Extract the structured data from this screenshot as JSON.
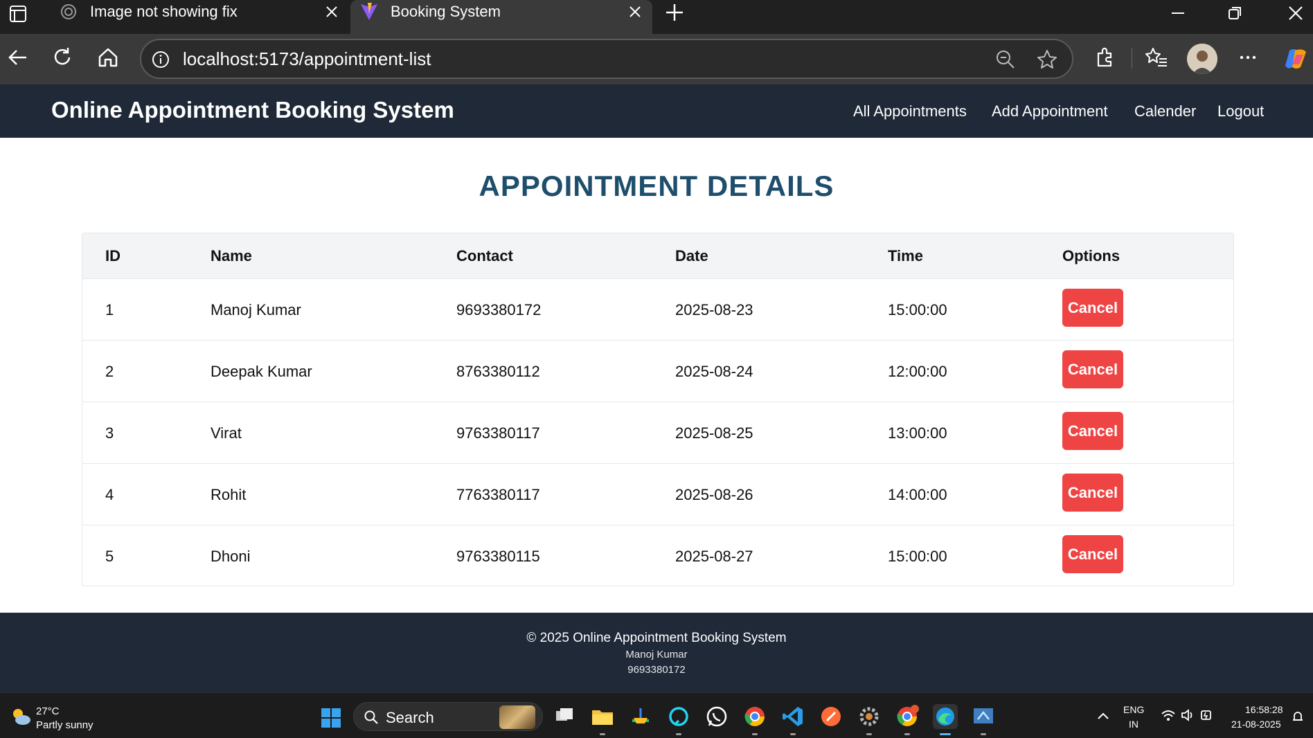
{
  "browser": {
    "tabs": [
      {
        "title": "Image not showing fix",
        "favicon": "openai-icon",
        "active": false
      },
      {
        "title": "Booking System",
        "favicon": "vite-icon",
        "active": true
      }
    ],
    "url": "localhost:5173/appointment-list"
  },
  "site": {
    "brand": "Online Appointment Booking System",
    "nav": [
      "All Appointments",
      "Add Appointment",
      "Calender",
      "Logout"
    ]
  },
  "page": {
    "title": "APPOINTMENT DETAILS",
    "columns": [
      "ID",
      "Name",
      "Contact",
      "Date",
      "Time",
      "Options"
    ],
    "rows": [
      {
        "id": "1",
        "name": "Manoj Kumar",
        "contact": "9693380172",
        "date": "2025-08-23",
        "time": "15:00:00",
        "action": "Cancel"
      },
      {
        "id": "2",
        "name": "Deepak Kumar",
        "contact": "8763380112",
        "date": "2025-08-24",
        "time": "12:00:00",
        "action": "Cancel"
      },
      {
        "id": "3",
        "name": "Virat",
        "contact": "9763380117",
        "date": "2025-08-25",
        "time": "13:00:00",
        "action": "Cancel"
      },
      {
        "id": "4",
        "name": "Rohit",
        "contact": "7763380117",
        "date": "2025-08-26",
        "time": "14:00:00",
        "action": "Cancel"
      },
      {
        "id": "5",
        "name": "Dhoni",
        "contact": "9763380115",
        "date": "2025-08-27",
        "time": "15:00:00",
        "action": "Cancel"
      }
    ]
  },
  "footer": {
    "copyright": "© 2025 Online Appointment Booking System",
    "author": "Manoj Kumar",
    "phone": "9693380172"
  },
  "taskbar": {
    "weather_temp": "27°C",
    "weather_desc": "Partly sunny",
    "search_label": "Search",
    "lang_top": "ENG",
    "lang_bottom": "IN",
    "time": "16:58:28",
    "date": "21-08-2025"
  },
  "colors": {
    "header_bg": "#1f2937",
    "title": "#1e4e6b",
    "cancel": "#ef4444"
  }
}
